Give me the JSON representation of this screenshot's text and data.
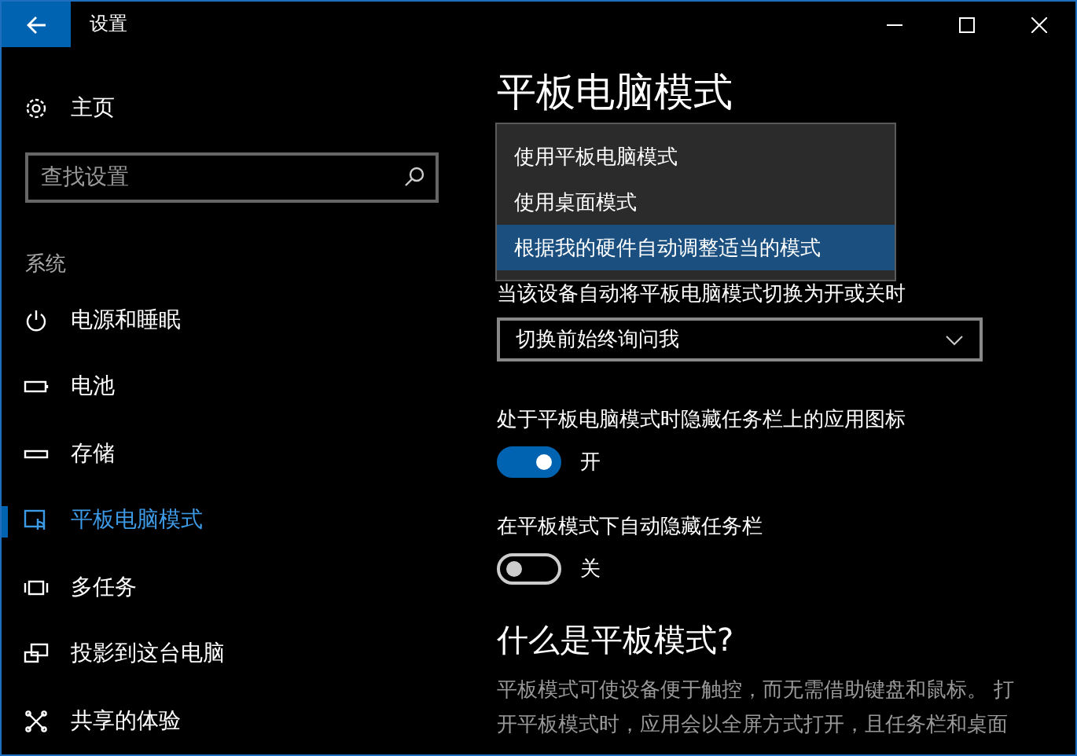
{
  "window": {
    "title": "设置"
  },
  "sidebar": {
    "home": "主页",
    "search": {
      "placeholder": "查找设置"
    },
    "section": "系统",
    "items": [
      {
        "label": "电源和睡眠",
        "kind": "power",
        "selected": false
      },
      {
        "label": "电池",
        "kind": "battery",
        "selected": false
      },
      {
        "label": "存储",
        "kind": "storage",
        "selected": false
      },
      {
        "label": "平板电脑模式",
        "kind": "tablet",
        "selected": true
      },
      {
        "label": "多任务",
        "kind": "multitask",
        "selected": false
      },
      {
        "label": "投影到这台电脑",
        "kind": "project",
        "selected": false
      },
      {
        "label": "共享的体验",
        "kind": "share",
        "selected": false
      }
    ]
  },
  "content": {
    "title": "平板电脑模式",
    "popup": [
      {
        "label": "使用平板电脑模式",
        "selected": false
      },
      {
        "label": "使用桌面模式",
        "selected": false
      },
      {
        "label": "根据我的硬件自动调整适当的模式",
        "selected": true
      }
    ],
    "switch_prompt": {
      "label": "当该设备自动将平板电脑模式切换为开或关时",
      "value": "切换前始终询问我"
    },
    "toggles": [
      {
        "label": "处于平板电脑模式时隐藏任务栏上的应用图标",
        "on": true,
        "state": "开"
      },
      {
        "label": "在平板模式下自动隐藏任务栏",
        "on": false,
        "state": "关"
      }
    ],
    "info": {
      "heading": "什么是平板模式?",
      "lines": [
        "平板模式可使设备便于触控，而无需借助键盘和鼠标。 打",
        "开平板模式时，应用会以全屏方式打开，且任务栏和桌面"
      ]
    }
  }
}
